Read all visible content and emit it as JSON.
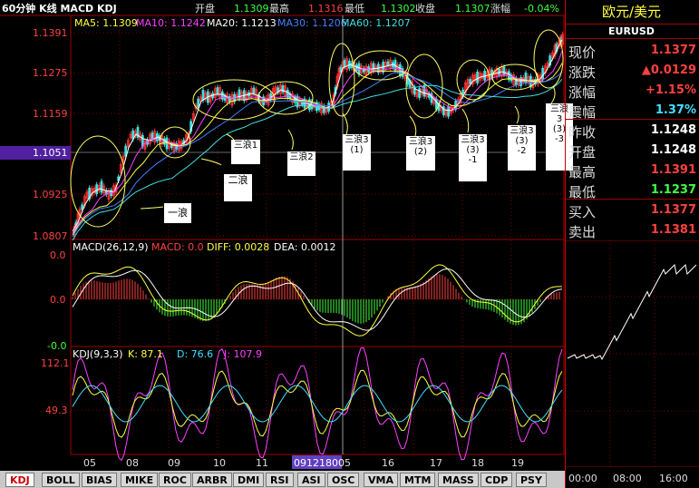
{
  "header": {
    "title": "60分钟 K线 MACD KDJ",
    "open_label": "开盘",
    "open_value": "1.1309",
    "high_label": "最高",
    "high_value": "1.1316",
    "low_label": "最低",
    "low_value": "1.1302",
    "close_label": "收盘",
    "close_value": "1.1307",
    "change_label": "涨幅",
    "change_value": "-0.04%"
  },
  "ma_line": {
    "ma5": "MA5: 1.1309",
    "ma10": "MA10: 1.1242",
    "ma20": "MA20: 1.1213",
    "ma30": "MA30: 1.1206",
    "ma60": "MA60: 1.1207"
  },
  "price_axis": [
    "1.1391",
    "1.1275",
    "1.1159",
    "1.1051",
    "1.0925",
    "1.0807"
  ],
  "current_price_tag": "1.1051",
  "macd": {
    "title": "MACD(26,12,9)",
    "macd": "MACD: 0.0",
    "diff": "DIFF: 0.0028",
    "dea": "DEA: 0.0012",
    "axis": [
      "0.0",
      "0.0",
      "-0.0"
    ]
  },
  "kdj": {
    "title": "KDJ(9,3,3)",
    "k": "K: 87.1",
    "d": "D: 76.6",
    "j": "J: 107.9",
    "axis": [
      "112.1",
      "49.3"
    ]
  },
  "date_axis": [
    "05",
    "08",
    "09",
    "10",
    "11",
    "5",
    "16",
    "17",
    "18",
    "19"
  ],
  "cursor_date": "09121800",
  "annotations": {
    "wave1": "一浪",
    "wave2": "二浪",
    "wave3_1": "三浪1",
    "wave3_2": "三浪2",
    "w31": [
      "三浪3",
      "(1)"
    ],
    "w32": [
      "三浪3",
      "(2)"
    ],
    "w33a": [
      "三浪3",
      "(3)",
      "-1"
    ],
    "w33b": [
      "三浪3",
      "(3)",
      "-2"
    ],
    "w33c": [
      "三浪3",
      "(3)",
      "-3"
    ]
  },
  "tabs": [
    "KDJ",
    "BOLL",
    "BIAS",
    "MIKE",
    "ROC",
    "ARBR",
    "DMI",
    "RSI",
    "ASI",
    "OSC",
    "VMA",
    "MTM",
    "MASS",
    "CDP",
    "PSY"
  ],
  "quote": {
    "pair_name": "欧元/美元",
    "symbol": "EURUSD",
    "rows": [
      {
        "label": "现价",
        "value": "1.1377",
        "color": "#ff4040"
      },
      {
        "label": "涨跌",
        "value": "▲0.0129",
        "color": "#ff4040"
      },
      {
        "label": "涨幅",
        "value": "+1.15%",
        "color": "#ff4040"
      },
      {
        "label": "震幅",
        "value": "1.37%",
        "color": "#40e0ff"
      },
      {
        "label": "昨收",
        "value": "1.1248",
        "color": "#ffffff"
      },
      {
        "label": "开盘",
        "value": "1.1248",
        "color": "#ffffff"
      },
      {
        "label": "最高",
        "value": "1.1391",
        "color": "#ff4040"
      },
      {
        "label": "最低",
        "value": "1.1237",
        "color": "#40ff40"
      },
      {
        "label": "买入",
        "value": "1.1377",
        "color": "#ff4040"
      },
      {
        "label": "卖出",
        "value": "1.1381",
        "color": "#ff4040"
      }
    ]
  },
  "mini_chart": {
    "times": [
      "00:00",
      "08:00",
      "16:00"
    ]
  },
  "colors": {
    "ma5": "#ffffff",
    "ma10": "#ff40ff",
    "ma20": "#ffff40",
    "ma30": "#4080ff",
    "ma60": "#40e0e0",
    "up_candle": "#ff3030",
    "down_candle": "#40e0e0",
    "grid": "#800000",
    "annotation": "#ffff66"
  }
}
